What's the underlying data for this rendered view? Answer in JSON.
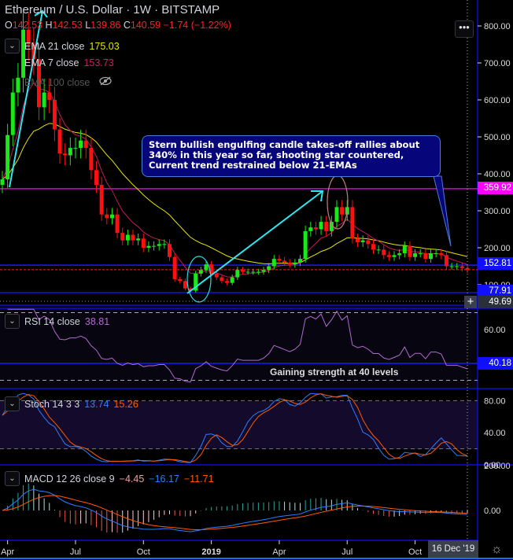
{
  "header": {
    "symbol": "Ethereum / U.S. Dollar",
    "interval": "1W",
    "exchange": "BITSTAMP",
    "sep": "·",
    "o_label": "O",
    "o": "142.53",
    "h_label": "H",
    "h": "142.53",
    "l_label": "L",
    "l": "139.86",
    "c_label": "C",
    "c": "140.59",
    "change": "−1.74 (−1.22%)"
  },
  "legends": {
    "ema21": {
      "label": "EMA 21 close",
      "value": "175.03",
      "color": "#e5e500"
    },
    "ema7": {
      "label": "EMA 7 close",
      "value": "153.73",
      "color": "#d81b60"
    },
    "ema100": {
      "label": "EMA 100 close",
      "hidden_icon": "eye-off-icon"
    },
    "rsi": {
      "label": "RSI 14 close",
      "value": "38.81",
      "color": "#b36ad1"
    },
    "stoch": {
      "label": "Stoch 14 3 3",
      "k": "13.74",
      "d": "15.26",
      "k_color": "#2a7fff",
      "d_color": "#ff5a00"
    },
    "macd": {
      "label": "MACD 12 26 close 9",
      "hist": "−4.45",
      "macd": "−16.17",
      "signal": "−11.71"
    }
  },
  "annotations": {
    "note": "Stern bullish engulfing candle takes-off rallies about 340% in this year so far, shooting star countered, Current trend restrained below 21-EMAs",
    "rsi_note": "Gaining strength at 40 levels"
  },
  "price_tags": {
    "resistance": "359.92",
    "support1": "152.81",
    "support2": "77.91",
    "crosshair": "49.69",
    "rsi_level": "40.18"
  },
  "date_tag": "16 Dec '19",
  "more_button": "•••",
  "chart_data": {
    "type": "candlestick",
    "title": "Ethereum / U.S. Dollar · 1W · BITSTAMP",
    "start_week": "2018-04-02",
    "interval": "1W",
    "first_open": 370,
    "closes": [
      385,
      505,
      620,
      660,
      790,
      750,
      710,
      580,
      620,
      600,
      520,
      455,
      450,
      470,
      470,
      490,
      470,
      410,
      370,
      290,
      280,
      290,
      240,
      220,
      235,
      220,
      225,
      200,
      205,
      205,
      210,
      210,
      175,
      115,
      110,
      90,
      84,
      130,
      140,
      155,
      130,
      120,
      110,
      105,
      120,
      140,
      135,
      135,
      135,
      135,
      140,
      150,
      170,
      165,
      160,
      155,
      160,
      170,
      245,
      255,
      250,
      270,
      245,
      270,
      310,
      290,
      310,
      225,
      215,
      220,
      210,
      195,
      195,
      180,
      175,
      180,
      185,
      205,
      175,
      185,
      185,
      170,
      185,
      185,
      180,
      150,
      150,
      150,
      145,
      140.59
    ],
    "price_axis": {
      "ticks": [
        "800.00",
        "700.00",
        "600.00",
        "500.00",
        "400.00",
        "300.00",
        "200.00",
        "100.00"
      ],
      "values": [
        800,
        700,
        600,
        500,
        400,
        300,
        200,
        100
      ],
      "range": [
        40,
        810
      ]
    },
    "time_axis": {
      "labels": [
        "Apr",
        "Jul",
        "Oct",
        "2019",
        "Apr",
        "Jul",
        "Oct"
      ],
      "week_index": [
        1,
        14,
        27,
        40,
        53,
        66,
        79
      ]
    },
    "horizontal_lines": [
      359.92,
      152.81,
      77.91
    ],
    "rsi_axis": {
      "ticks": [
        "60.00"
      ],
      "values": [
        60
      ],
      "bands": [
        70,
        30
      ],
      "level": 40
    },
    "stoch_axis": {
      "ticks": [
        "80.00",
        "40.00",
        "0.00"
      ],
      "values": [
        80,
        40,
        0
      ],
      "bands": [
        80,
        20
      ]
    },
    "macd_axis": {
      "ticks": [
        "200.00",
        "0.00"
      ],
      "values": [
        200,
        0
      ]
    },
    "series": [
      {
        "name": "EMA 21",
        "period": 21
      },
      {
        "name": "EMA 7",
        "period": 7
      },
      {
        "name": "RSI",
        "period": 14
      },
      {
        "name": "Stoch",
        "params": [
          14,
          3,
          3
        ]
      },
      {
        "name": "MACD",
        "params": [
          12,
          26,
          9
        ]
      }
    ]
  }
}
